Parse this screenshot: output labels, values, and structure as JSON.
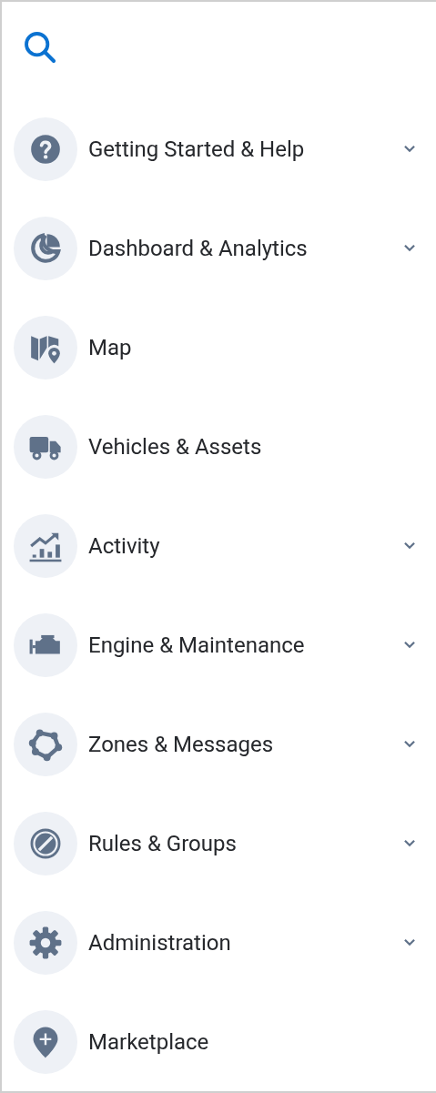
{
  "menu": [
    {
      "label": "Getting Started & Help",
      "expandable": true
    },
    {
      "label": "Dashboard & Analytics",
      "expandable": true
    },
    {
      "label": "Map",
      "expandable": false
    },
    {
      "label": "Vehicles & Assets",
      "expandable": false
    },
    {
      "label": "Activity",
      "expandable": true
    },
    {
      "label": "Engine & Maintenance",
      "expandable": true
    },
    {
      "label": "Zones & Messages",
      "expandable": true
    },
    {
      "label": "Rules & Groups",
      "expandable": true
    },
    {
      "label": "Administration",
      "expandable": true
    },
    {
      "label": "Marketplace",
      "expandable": false
    }
  ]
}
